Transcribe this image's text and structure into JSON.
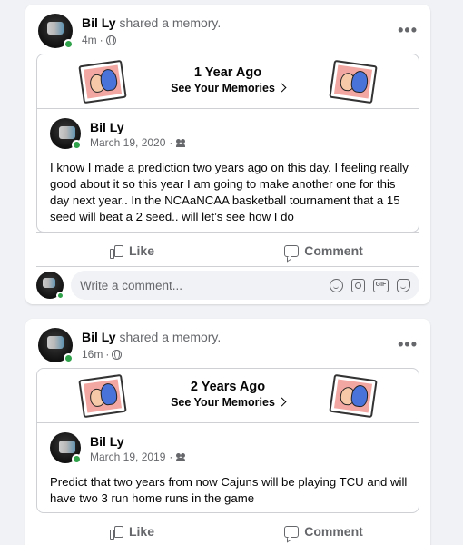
{
  "posts": [
    {
      "author": "Bil Ly",
      "action": "shared a memory.",
      "time": "4m",
      "memory": {
        "title": "1 Year Ago",
        "link_label": "See Your Memories",
        "original_author": "Bil Ly",
        "original_date": "March 19, 2020",
        "text": "I know I made a prediction two years ago on this day. I feeling really good about it so this year I am going to make another one for this day next year.. In the NCAaNCAA basketball tournament that a 15 seed will beat a 2 seed.. will let’s see how I do"
      },
      "like_label": "Like",
      "comment_label": "Comment",
      "comment_placeholder": "Write a comment...",
      "gif_label": "GIF"
    },
    {
      "author": "Bil Ly",
      "action": "shared a memory.",
      "time": "16m",
      "memory": {
        "title": "2 Years Ago",
        "link_label": "See Your Memories",
        "original_author": "Bil Ly",
        "original_date": "March 19, 2019",
        "text": "Predict that two years from now Cajuns will be playing TCU and will have two 3 run home runs in the game"
      },
      "like_label": "Like",
      "comment_label": "Comment"
    }
  ],
  "colors": {
    "background": "#f0f2f5",
    "secondary_text": "#65676b",
    "online_dot": "#31a24c",
    "border": "#ced0d4"
  },
  "icons": [
    "globe-icon",
    "more-options-icon",
    "chevron-right-icon",
    "friends-audience-icon",
    "like-icon",
    "comment-icon",
    "emoji-icon",
    "camera-icon",
    "gif-icon",
    "sticker-icon"
  ]
}
